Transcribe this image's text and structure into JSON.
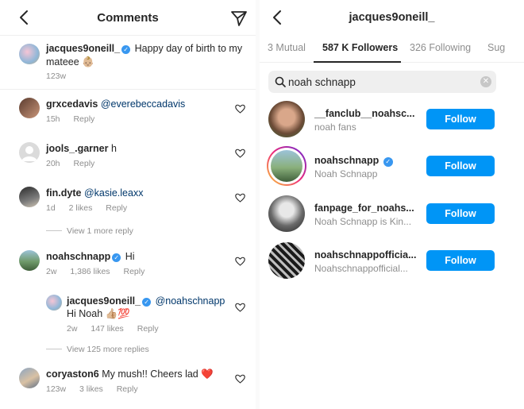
{
  "comments_panel": {
    "title": "Comments",
    "caption": {
      "username": "jacques9oneill_",
      "text": "Happy day of birth to my mateee 👶🏼",
      "time": "123w"
    },
    "comments": [
      {
        "username": "grxcedavis",
        "text": "",
        "mention": "@everebeccadavis",
        "time": "15h",
        "reply_label": "Reply",
        "likes": ""
      },
      {
        "username": "jools_.garner",
        "text": "h",
        "mention": "",
        "time": "20h",
        "reply_label": "Reply",
        "likes": ""
      },
      {
        "username": "fin.dyte",
        "text": "",
        "mention": "@kasie.leaxx",
        "time": "1d",
        "likes": "2 likes",
        "reply_label": "Reply",
        "view_replies": "View 1 more reply"
      },
      {
        "username": "noahschnapp",
        "text": "Hi",
        "mention": "",
        "time": "2w",
        "likes": "1,386 likes",
        "reply_label": "Reply",
        "view_replies": "View 125 more replies",
        "reply": {
          "username": "jacques9oneill_",
          "mention": "@noahschnapp",
          "text": "Hi Noah 👍🏼💯",
          "time": "2w",
          "likes": "147 likes",
          "reply_label": "Reply"
        }
      },
      {
        "username": "coryaston6",
        "text": "My mush!! Cheers lad ❤️",
        "mention": "",
        "time": "123w",
        "likes": "3 likes",
        "reply_label": "Reply"
      }
    ]
  },
  "followers_panel": {
    "title": "jacques9oneill_",
    "tabs": [
      "3 Mutual",
      "587 K Followers",
      "326 Following",
      "Sug"
    ],
    "active_tab": "587 K Followers",
    "search": {
      "value": "noah schnapp",
      "placeholder": "Search"
    },
    "users": [
      {
        "username": "__fanclub__noahsc...",
        "name": "noah fans",
        "verified": false,
        "button": "Follow"
      },
      {
        "username": "noahschnapp",
        "name": "Noah Schnapp",
        "verified": true,
        "button": "Follow"
      },
      {
        "username": "fanpage_for_noahs...",
        "name": "Noah Schnapp is Kin...",
        "verified": false,
        "button": "Follow"
      },
      {
        "username": "noahschnappofficia...",
        "name": "Noahschnappofficial...",
        "verified": false,
        "button": "Follow"
      }
    ]
  },
  "icons": {
    "back": "chevron-left-icon",
    "send": "paper-plane-icon",
    "like": "heart-outline-icon",
    "search": "search-icon",
    "clear": "clear-circle-icon",
    "verified": "verified-badge-icon"
  },
  "colors": {
    "follow_button": "#0095f6",
    "verified": "#3897f0",
    "mention": "#00376b",
    "secondary_text": "#8e8e8e"
  }
}
